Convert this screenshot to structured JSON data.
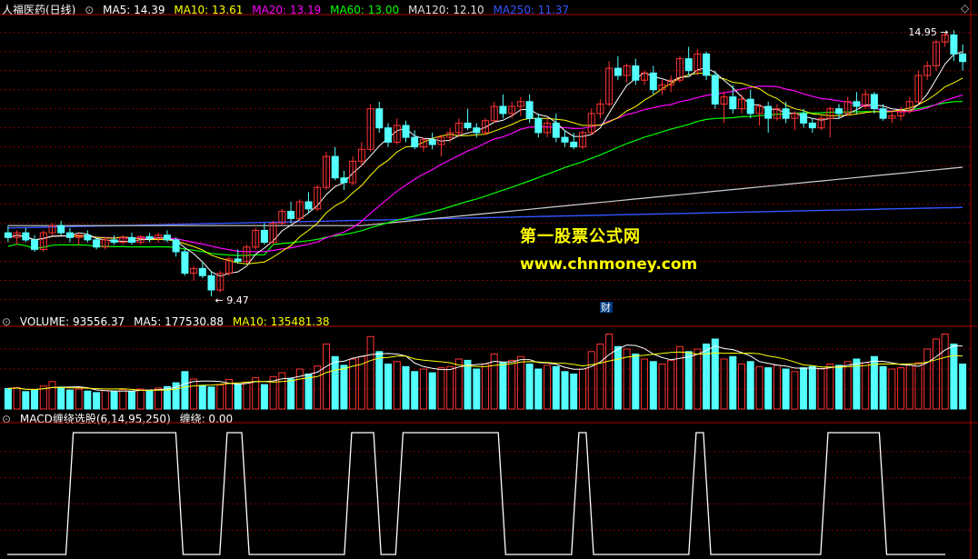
{
  "main_panel": {
    "stock_name": "人福医药(日线)",
    "ma_legend": [
      {
        "label": "MA5: 14.39",
        "color": "#ffffff"
      },
      {
        "label": "MA10: 13.61",
        "color": "#ffff00"
      },
      {
        "label": "MA20: 13.19",
        "color": "#ff00ff"
      },
      {
        "label": "MA60: 13.00",
        "color": "#00ff00"
      },
      {
        "label": "MA120: 12.10",
        "color": "#dddddd"
      },
      {
        "label": "MA250: 11.37",
        "color": "#3355ff"
      }
    ],
    "high_label": "14.95",
    "low_label": "9.47",
    "fin_marker": "财"
  },
  "volume_panel": {
    "label": "VOLUME: 93556.37",
    "ma5": "MA5: 177530.88",
    "ma10": "MA10: 135481.38"
  },
  "macd_panel": {
    "label": "MACD缠绕选股(6,14,95,250)",
    "value": "缠绕: 0.00"
  },
  "watermark": {
    "line1": "第一股票公式网",
    "line2": "www.chnmoney.com"
  },
  "colors": {
    "up": "#ff3232",
    "down": "#54ffff",
    "grid": "#800000",
    "frame": "#b00000"
  },
  "chart_data": {
    "type": "candlestick",
    "ylim": [
      9.2,
      15.3
    ],
    "price_ticks": [
      9.4,
      9.8,
      10.2,
      10.6,
      11.0,
      11.4,
      11.8,
      12.2,
      12.6,
      13.0,
      13.4,
      13.8,
      14.2,
      14.6,
      15.0
    ],
    "ohlc": [
      [
        10.8,
        10.95,
        10.6,
        10.7
      ],
      [
        10.7,
        10.85,
        10.55,
        10.8
      ],
      [
        10.8,
        10.9,
        10.6,
        10.65
      ],
      [
        10.65,
        10.75,
        10.4,
        10.45
      ],
      [
        10.45,
        10.85,
        10.4,
        10.8
      ],
      [
        10.8,
        11.0,
        10.75,
        10.95
      ],
      [
        10.95,
        11.05,
        10.75,
        10.8
      ],
      [
        10.8,
        10.9,
        10.6,
        10.7
      ],
      [
        10.7,
        10.8,
        10.55,
        10.75
      ],
      [
        10.75,
        10.85,
        10.6,
        10.65
      ],
      [
        10.65,
        10.7,
        10.45,
        10.5
      ],
      [
        10.5,
        10.7,
        10.45,
        10.65
      ],
      [
        10.65,
        10.75,
        10.55,
        10.6
      ],
      [
        10.6,
        10.75,
        10.55,
        10.7
      ],
      [
        10.7,
        10.8,
        10.55,
        10.6
      ],
      [
        10.6,
        10.75,
        10.55,
        10.72
      ],
      [
        10.72,
        10.8,
        10.6,
        10.68
      ],
      [
        10.68,
        10.8,
        10.6,
        10.75
      ],
      [
        10.75,
        10.85,
        10.6,
        10.65
      ],
      [
        10.65,
        10.7,
        10.3,
        10.4
      ],
      [
        10.4,
        10.45,
        9.9,
        9.95
      ],
      [
        9.95,
        10.1,
        9.8,
        10.05
      ],
      [
        10.05,
        10.2,
        9.85,
        9.9
      ],
      [
        9.9,
        10.0,
        9.47,
        9.6
      ],
      [
        9.6,
        10.0,
        9.55,
        9.95
      ],
      [
        9.95,
        10.3,
        9.9,
        10.25
      ],
      [
        10.25,
        10.45,
        10.15,
        10.2
      ],
      [
        10.2,
        10.55,
        10.15,
        10.5
      ],
      [
        10.5,
        10.9,
        10.45,
        10.85
      ],
      [
        10.85,
        11.0,
        10.55,
        10.6
      ],
      [
        10.6,
        11.05,
        10.55,
        11.0
      ],
      [
        11.0,
        11.3,
        10.95,
        11.25
      ],
      [
        11.25,
        11.45,
        11.0,
        11.1
      ],
      [
        11.1,
        11.5,
        11.05,
        11.45
      ],
      [
        11.45,
        11.65,
        11.2,
        11.3
      ],
      [
        11.3,
        11.8,
        11.25,
        11.75
      ],
      [
        11.75,
        12.5,
        11.7,
        12.4
      ],
      [
        12.4,
        12.6,
        11.9,
        11.95
      ],
      [
        11.95,
        12.1,
        11.7,
        11.85
      ],
      [
        11.85,
        12.4,
        11.8,
        12.3
      ],
      [
        12.3,
        12.7,
        12.2,
        12.55
      ],
      [
        12.55,
        13.5,
        12.5,
        13.4
      ],
      [
        13.4,
        13.55,
        12.9,
        13.0
      ],
      [
        13.0,
        13.1,
        12.6,
        12.7
      ],
      [
        12.7,
        13.2,
        12.65,
        13.05
      ],
      [
        13.05,
        13.15,
        12.7,
        12.8
      ],
      [
        12.8,
        12.95,
        12.55,
        12.6
      ],
      [
        12.6,
        12.8,
        12.5,
        12.75
      ],
      [
        12.75,
        12.9,
        12.55,
        12.65
      ],
      [
        12.65,
        12.85,
        12.4,
        12.8
      ],
      [
        12.8,
        13.0,
        12.7,
        12.9
      ],
      [
        12.9,
        13.2,
        12.8,
        13.1
      ],
      [
        13.1,
        13.4,
        12.95,
        13.0
      ],
      [
        13.0,
        13.1,
        12.8,
        12.9
      ],
      [
        12.9,
        13.2,
        12.85,
        13.15
      ],
      [
        13.15,
        13.55,
        13.1,
        13.45
      ],
      [
        13.45,
        13.7,
        13.2,
        13.3
      ],
      [
        13.3,
        13.55,
        13.2,
        13.45
      ],
      [
        13.45,
        13.65,
        13.25,
        13.55
      ],
      [
        13.55,
        13.7,
        13.1,
        13.2
      ],
      [
        13.2,
        13.3,
        12.8,
        12.9
      ],
      [
        12.9,
        13.2,
        12.8,
        13.1
      ],
      [
        13.1,
        13.3,
        12.7,
        12.8
      ],
      [
        12.8,
        12.95,
        12.6,
        12.7
      ],
      [
        12.7,
        12.9,
        12.55,
        12.6
      ],
      [
        12.6,
        12.95,
        12.55,
        12.9
      ],
      [
        12.9,
        13.4,
        12.85,
        13.3
      ],
      [
        13.3,
        13.6,
        13.2,
        13.5
      ],
      [
        13.5,
        14.4,
        13.45,
        14.25
      ],
      [
        14.25,
        14.5,
        14.0,
        14.1
      ],
      [
        14.1,
        14.35,
        13.95,
        14.3
      ],
      [
        14.3,
        14.45,
        13.9,
        14.0
      ],
      [
        14.0,
        14.2,
        13.9,
        14.15
      ],
      [
        14.15,
        14.3,
        13.7,
        13.8
      ],
      [
        13.8,
        14.0,
        13.7,
        13.9
      ],
      [
        13.9,
        14.1,
        13.75,
        14.0
      ],
      [
        14.0,
        14.5,
        13.95,
        14.45
      ],
      [
        14.45,
        14.7,
        14.1,
        14.2
      ],
      [
        14.2,
        14.65,
        14.1,
        14.55
      ],
      [
        14.55,
        14.6,
        14.0,
        14.1
      ],
      [
        14.1,
        14.2,
        13.4,
        13.5
      ],
      [
        13.5,
        13.75,
        13.1,
        13.65
      ],
      [
        13.65,
        13.9,
        13.3,
        13.4
      ],
      [
        13.4,
        13.7,
        13.3,
        13.6
      ],
      [
        13.6,
        13.8,
        13.2,
        13.3
      ],
      [
        13.3,
        13.5,
        13.05,
        13.45
      ],
      [
        13.45,
        13.55,
        12.9,
        13.2
      ],
      [
        13.2,
        13.5,
        13.15,
        13.4
      ],
      [
        13.4,
        13.55,
        13.1,
        13.2
      ],
      [
        13.2,
        13.35,
        12.95,
        13.3
      ],
      [
        13.3,
        13.4,
        13.0,
        13.1
      ],
      [
        13.1,
        13.2,
        12.9,
        13.0
      ],
      [
        13.0,
        13.25,
        12.95,
        13.2
      ],
      [
        13.2,
        13.45,
        12.8,
        13.4
      ],
      [
        13.4,
        13.5,
        13.2,
        13.3
      ],
      [
        13.3,
        13.65,
        13.25,
        13.55
      ],
      [
        13.55,
        13.75,
        13.3,
        13.45
      ],
      [
        13.45,
        13.8,
        13.4,
        13.7
      ],
      [
        13.7,
        13.75,
        13.3,
        13.4
      ],
      [
        13.4,
        13.5,
        13.15,
        13.2
      ],
      [
        13.2,
        13.35,
        13.1,
        13.25
      ],
      [
        13.25,
        13.45,
        13.15,
        13.35
      ],
      [
        13.35,
        13.65,
        13.3,
        13.55
      ],
      [
        13.55,
        14.2,
        13.5,
        14.1
      ],
      [
        14.1,
        14.4,
        14.0,
        14.3
      ],
      [
        14.3,
        14.85,
        14.2,
        14.8
      ],
      [
        14.8,
        15.0,
        14.7,
        14.95
      ],
      [
        14.95,
        15.05,
        14.4,
        14.55
      ],
      [
        14.55,
        14.75,
        14.2,
        14.39
      ]
    ],
    "volume": [
      82,
      86,
      70,
      75,
      92,
      110,
      88,
      76,
      80,
      72,
      66,
      74,
      70,
      78,
      72,
      80,
      76,
      84,
      90,
      105,
      150,
      120,
      95,
      88,
      96,
      118,
      100,
      108,
      125,
      98,
      130,
      145,
      120,
      160,
      140,
      172,
      260,
      210,
      175,
      200,
      210,
      290,
      230,
      180,
      190,
      170,
      150,
      160,
      145,
      165,
      170,
      200,
      195,
      160,
      180,
      220,
      185,
      195,
      210,
      180,
      160,
      175,
      170,
      150,
      140,
      160,
      230,
      260,
      300,
      250,
      240,
      220,
      200,
      190,
      180,
      195,
      250,
      230,
      240,
      260,
      280,
      200,
      210,
      180,
      190,
      170,
      165,
      175,
      160,
      150,
      165,
      170,
      160,
      180,
      175,
      190,
      200,
      185,
      210,
      170,
      160,
      165,
      175,
      185,
      240,
      280,
      300,
      260,
      180
    ],
    "volume_max": 320,
    "macd_wrap": [
      0,
      0,
      0,
      0,
      0,
      0,
      0,
      0,
      0,
      1,
      1,
      1,
      1,
      1,
      1,
      1,
      1,
      1,
      1,
      1,
      1,
      1,
      1,
      1,
      0,
      0,
      0,
      0,
      0,
      0,
      1,
      1,
      1,
      0,
      0,
      0,
      0,
      0,
      0,
      0,
      0,
      0,
      0,
      0,
      0,
      0,
      0,
      1,
      1,
      1,
      1,
      0,
      0,
      0,
      1,
      1,
      1,
      1,
      1,
      1,
      1,
      1,
      1,
      1,
      1,
      1,
      1,
      1,
      0,
      0,
      0,
      0,
      0,
      0,
      0,
      0,
      0,
      0,
      1,
      1,
      0,
      0,
      0,
      0,
      0,
      0,
      0,
      0,
      0,
      0,
      0,
      0,
      0,
      0,
      1,
      1,
      0,
      0,
      0,
      0,
      0,
      0,
      0,
      0,
      0,
      0,
      0,
      0,
      0,
      0,
      0,
      0,
      1,
      1,
      1,
      1,
      1,
      1,
      1,
      1,
      0,
      0,
      0,
      0,
      0,
      0,
      0,
      0,
      0
    ]
  }
}
